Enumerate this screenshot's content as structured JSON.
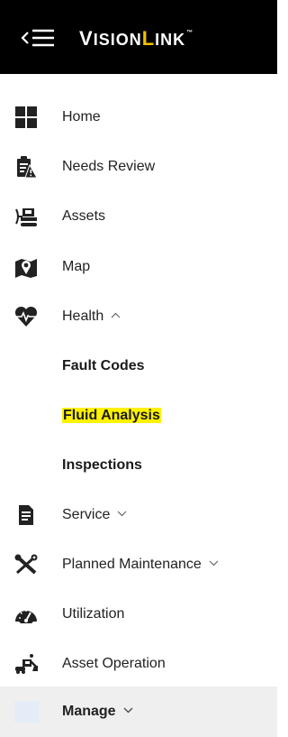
{
  "header": {
    "logo_prefix": "V",
    "logo_mid": "ISION",
    "logo_accent": "L",
    "logo_suffix": "INK",
    "trademark": "™"
  },
  "nav": {
    "home": "Home",
    "needs_review": "Needs Review",
    "assets": "Assets",
    "map": "Map",
    "health": "Health",
    "fault_codes": "Fault Codes",
    "fluid_analysis": "Fluid Analysis",
    "inspections": "Inspections",
    "service": "Service",
    "planned_maintenance": "Planned Maintenance",
    "utilization": "Utilization",
    "asset_operation": "Asset Operation",
    "manage": "Manage"
  },
  "colors": {
    "topbar": "#000000",
    "brand_accent": "#f2c200",
    "highlight": "#fff200",
    "active_row": "#efefef"
  },
  "icons": [
    "collapse-menu-icon",
    "home-icon",
    "needs-review-icon",
    "assets-icon",
    "map-icon",
    "health-icon",
    "service-icon",
    "planned-maintenance-icon",
    "utilization-icon",
    "asset-operation-icon",
    "manage-icon"
  ]
}
